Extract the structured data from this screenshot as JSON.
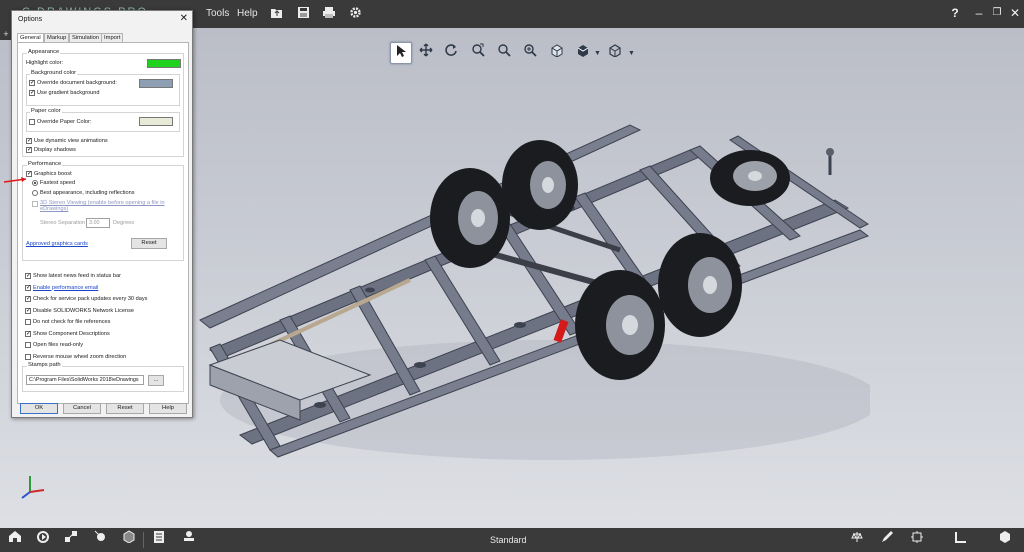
{
  "topbar": {
    "brand": "C DRAWINGS PRO",
    "menu": [
      "Tools",
      "Help"
    ],
    "icons": [
      "open-folder-icon",
      "save-icon",
      "print-icon",
      "gear-icon"
    ],
    "window_controls": [
      "help-icon",
      "minimize-icon",
      "restore-icon",
      "close-icon"
    ]
  },
  "view_toolbar": {
    "tools": [
      "select-icon",
      "pan-icon",
      "rotate-icon",
      "zoom-fit-icon",
      "zoom-in-icon",
      "zoom-area-icon",
      "view-box-icon",
      "display-style-icon",
      "view-orientation-icon"
    ]
  },
  "dialog": {
    "title": "Options",
    "tabs": [
      "General",
      "Markup",
      "Simulation",
      "Import"
    ],
    "appearance": {
      "label": "Appearance",
      "highlight_color": "Highlight color:",
      "highlight_hex": "#1ed21e",
      "background_color": {
        "label": "Background color",
        "override": "Override document background:",
        "gradient": "Use gradient background",
        "swatch_hex": "#8e9fb4"
      },
      "paper_color": {
        "label": "Paper color",
        "override": "Override Paper Color:",
        "swatch_hex": "#e8ead8"
      },
      "dynamic": "Use dynamic view animations",
      "shadows": "Display shadows"
    },
    "performance": {
      "label": "Performance",
      "graphics_boost": "Graphics boost",
      "fastest": "Fastest speed",
      "best": "Best appearance, including reflections",
      "stereo": "3D Stereo Viewing (enable before opening a file in eDrawings)",
      "stereo_sep_label": "Stereo Separation",
      "stereo_sep_value": "3.00",
      "stereo_sep_unit": "Degrees",
      "approved_link": "Approved graphics cards",
      "reset": "Reset"
    },
    "options": [
      {
        "label": "Show latest news feed in status bar",
        "checked": true,
        "link": false
      },
      {
        "label": "Enable performance email",
        "checked": true,
        "link": true
      },
      {
        "label": "Check for service pack updates every 30 days",
        "checked": true,
        "link": false
      },
      {
        "label": "Disable SOLIDWORKS Network License",
        "checked": true,
        "link": false
      },
      {
        "label": "Do not check for file references",
        "checked": false,
        "link": false
      },
      {
        "label": "Show Component Descriptions",
        "checked": true,
        "link": false
      },
      {
        "label": "Open files read-only",
        "checked": false,
        "link": false
      },
      {
        "label": "Reverse mouse wheel zoom direction",
        "checked": false,
        "link": false
      }
    ],
    "stamps": {
      "label": "Stamps path",
      "path": "C:\\Program Files\\SolidWorks 2018\\eDrawings",
      "browse": "..."
    },
    "buttons": {
      "ok": "OK",
      "cancel": "Cancel",
      "reset": "Reset",
      "help": "Help"
    }
  },
  "statusbar": {
    "center": "Standard",
    "left_icons": [
      "home-icon",
      "animate-icon",
      "explode-icon",
      "move-icon",
      "section-icon",
      "sheet-icon",
      "stamp-icon"
    ],
    "right_icons": [
      "measure-icon",
      "markup-icon",
      "annotation-icon",
      "dimension-icon",
      "components-icon"
    ]
  }
}
